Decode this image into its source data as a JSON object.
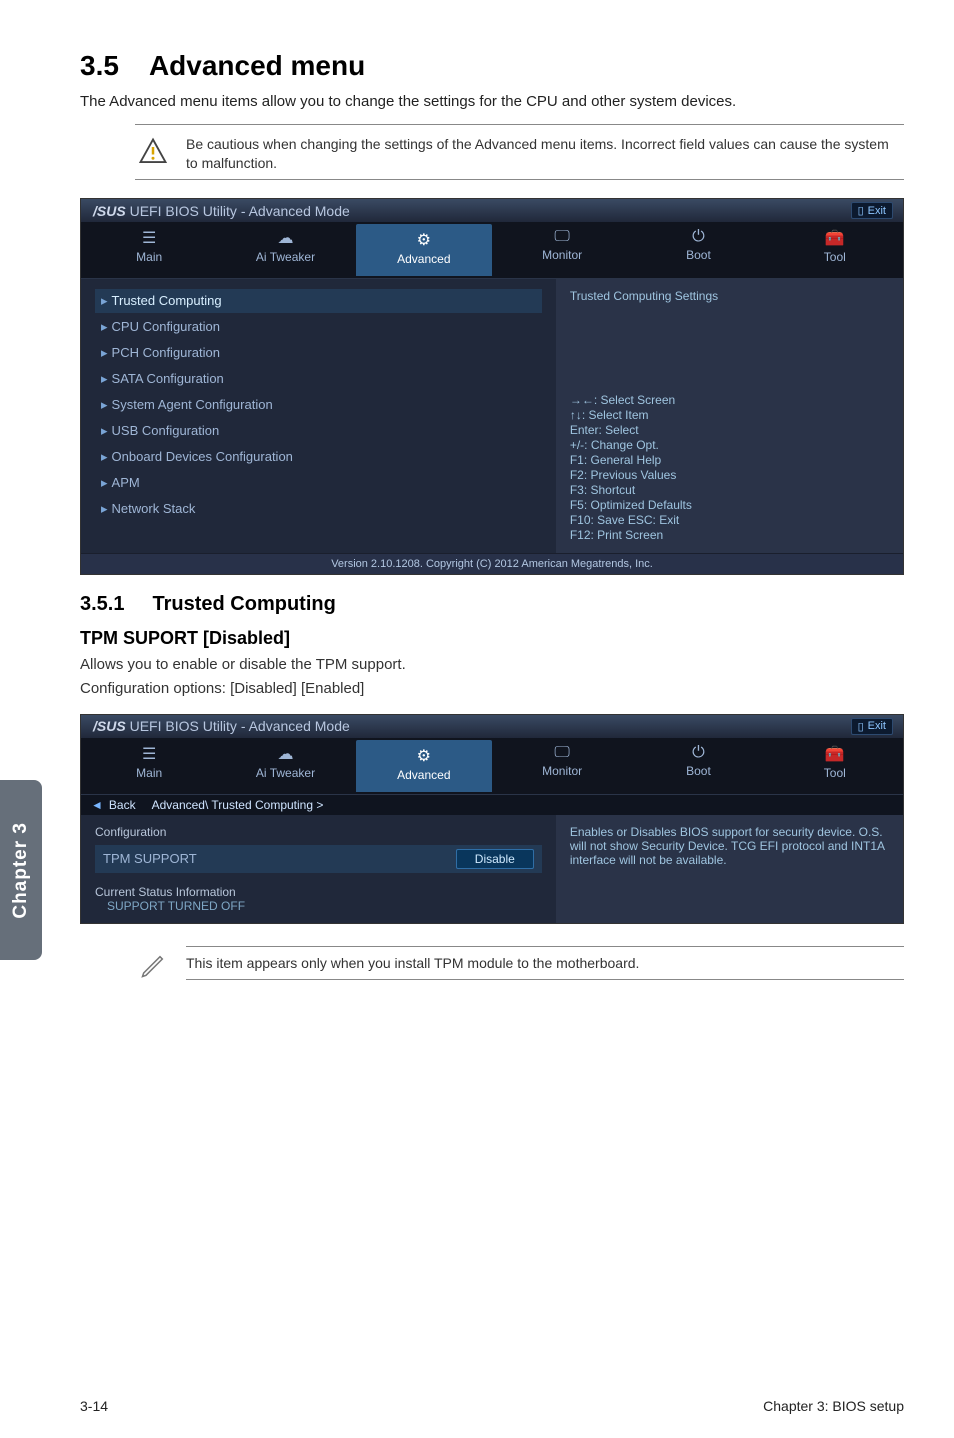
{
  "page": {
    "section_number": "3.5",
    "section_title": "Advanced menu",
    "intro": "The Advanced menu items allow you to change the settings for the CPU and other system devices.",
    "caution": "Be cautious when changing the settings of the Advanced menu items. Incorrect field values can cause the system to malfunction.",
    "subsection_number": "3.5.1",
    "subsection_title": "Trusted Computing",
    "setting_heading": "TPM SUPORT [Disabled]",
    "setting_desc": "Allows you to enable or disable the TPM support.",
    "setting_options": "Configuration options: [Disabled] [Enabled]",
    "note": "This item appears only when you install TPM module to the motherboard.",
    "chapter_tab": "Chapter 3",
    "footer_left": "3-14",
    "footer_right": "Chapter 3: BIOS setup"
  },
  "bios1": {
    "title": "UEFI BIOS Utility - Advanced Mode",
    "brand": "/SUS",
    "exit_label": "Exit",
    "tabs": [
      "Main",
      "Ai Tweaker",
      "Advanced",
      "Monitor",
      "Boot",
      "Tool"
    ],
    "menu_items": [
      "Trusted Computing",
      "CPU Configuration",
      "PCH Configuration",
      "SATA Configuration",
      "System Agent Configuration",
      "USB Configuration",
      "Onboard Devices Configuration",
      "APM",
      "Network Stack"
    ],
    "side_header": "Trusted Computing Settings",
    "hints": [
      "→←: Select Screen",
      "↑↓: Select Item",
      "Enter: Select",
      "+/-: Change Opt.",
      "F1: General Help",
      "F2: Previous Values",
      "F3: Shortcut",
      "F5: Optimized Defaults",
      "F10: Save  ESC: Exit",
      "F12: Print Screen"
    ],
    "footer": "Version 2.10.1208. Copyright (C) 2012 American Megatrends, Inc."
  },
  "bios2": {
    "title": "UEFI BIOS Utility - Advanced Mode",
    "brand": "/SUS",
    "exit_label": "Exit",
    "tabs": [
      "Main",
      "Ai Tweaker",
      "Advanced",
      "Monitor",
      "Boot",
      "Tool"
    ],
    "back_label": "Back",
    "breadcrumb": "Advanced\\ Trusted Computing >",
    "config_header": "Configuration",
    "support_label": "TPM SUPPORT",
    "support_value": "Disable",
    "status_header": "Current Status Information",
    "status_sub": "SUPPORT TURNED OFF",
    "side_help": "Enables or Disables BIOS support for security device. O.S. will not show Security Device. TCG EFI protocol and INT1A interface will not be available."
  }
}
